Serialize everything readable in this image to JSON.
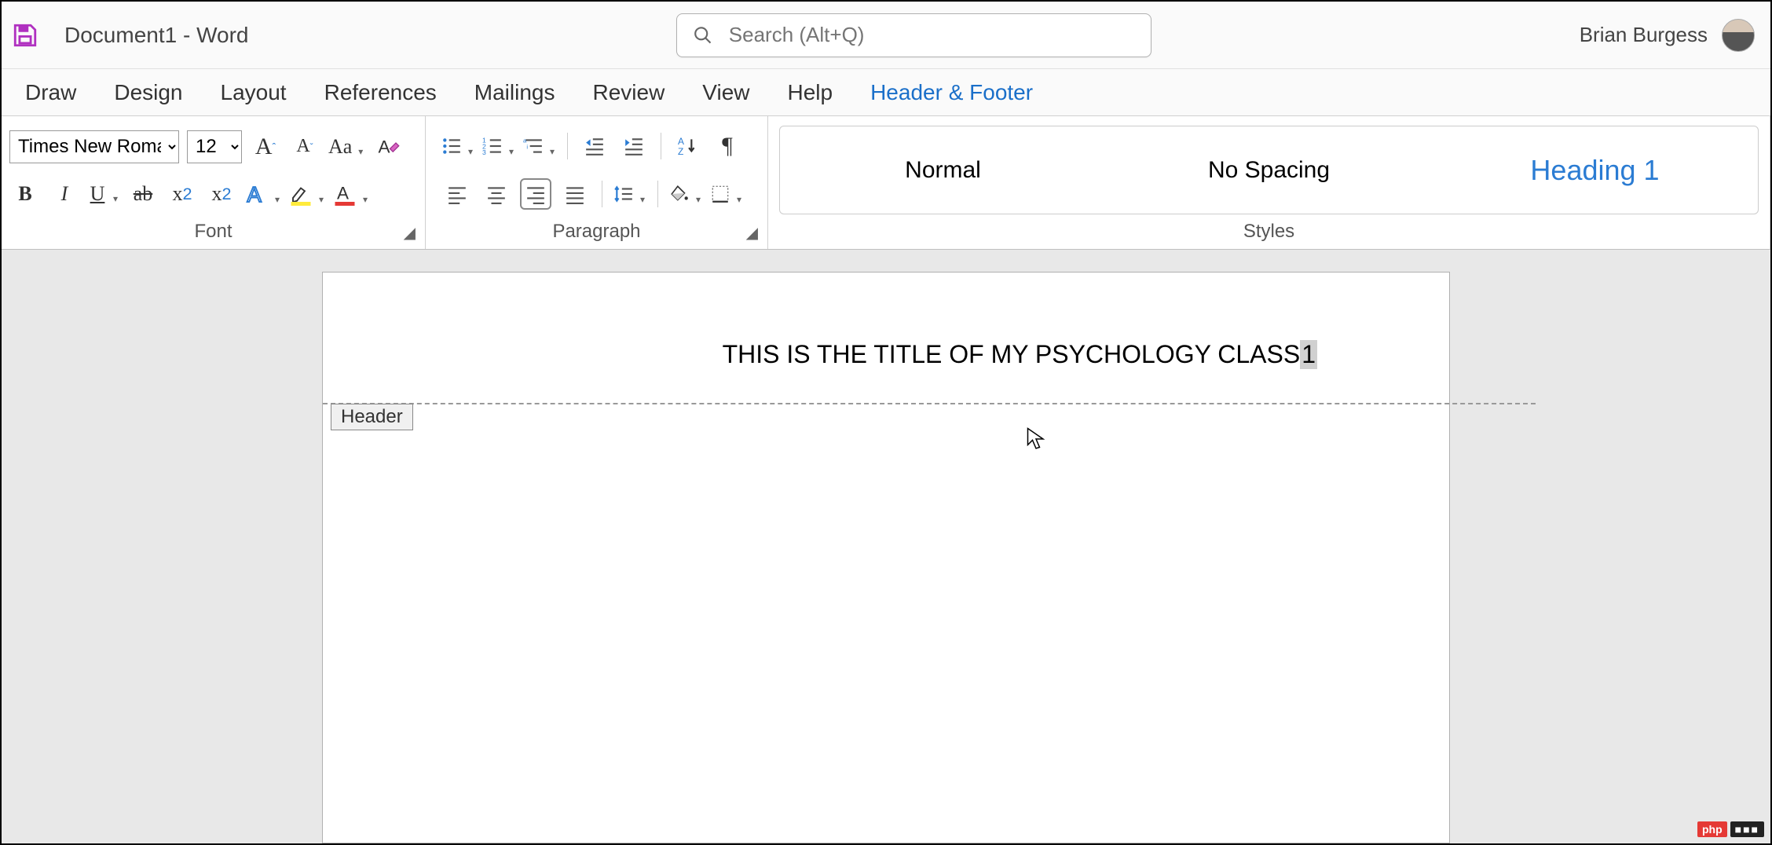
{
  "title_bar": {
    "document_title": "Document1  -  Word",
    "search_placeholder": "Search (Alt+Q)",
    "user_name": "Brian Burgess"
  },
  "tabs": {
    "items": [
      "Draw",
      "Design",
      "Layout",
      "References",
      "Mailings",
      "Review",
      "View",
      "Help",
      "Header & Footer"
    ],
    "active_index": 8
  },
  "ribbon": {
    "font_group": {
      "label": "Font",
      "font_name": "Times New Roman",
      "font_size": "12"
    },
    "paragraph_group": {
      "label": "Paragraph"
    },
    "styles_group": {
      "label": "Styles",
      "items": [
        "Normal",
        "No Spacing",
        "Heading 1"
      ]
    }
  },
  "document": {
    "header_text": "THIS IS THE TITLE OF MY PSYCHOLOGY CLASS",
    "page_number": "1",
    "header_tag": "Header"
  },
  "watermark": {
    "left": "php",
    "right": "■■■"
  }
}
